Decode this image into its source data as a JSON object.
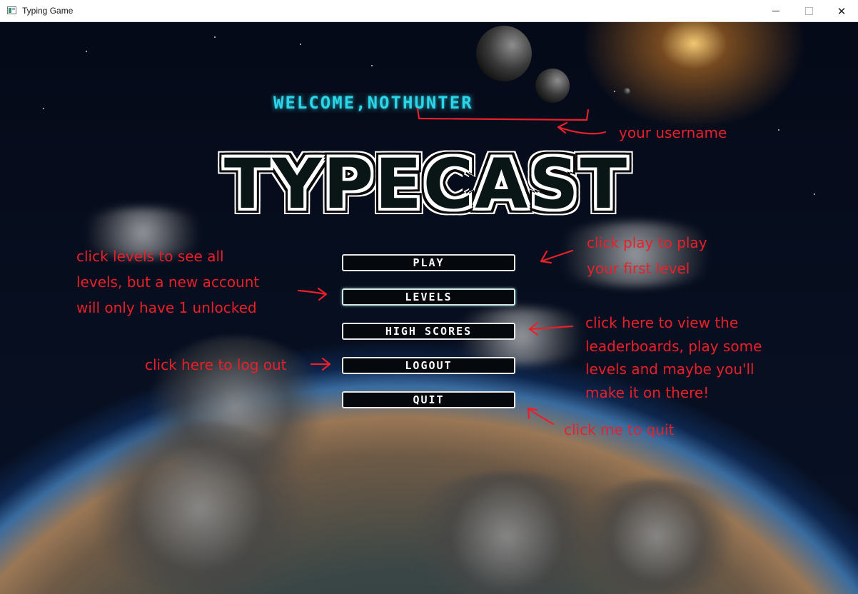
{
  "window": {
    "title": "Typing Game",
    "controls": [
      "minimize",
      "maximize",
      "close"
    ],
    "close_glyph": "✕"
  },
  "game": {
    "welcome_prefix": "WELCOME, ",
    "username": "NOTHUNTER",
    "logo": "TYPECAST",
    "accent_color": "#2ad6e8"
  },
  "menu": {
    "play": "PLAY",
    "levels": "LEVELS",
    "high_scores": "HIGH SCORES",
    "logout": "LOGOUT",
    "quit": "QUIT"
  },
  "annotations": {
    "color": "#e8202a",
    "username_note": "your username",
    "play_note": [
      "click play to play",
      "your first level"
    ],
    "levels_note": [
      "click levels to see all",
      "levels, but a new account",
      "will only have 1 unlocked"
    ],
    "high_scores_note": [
      "click here to view the",
      "leaderboards, play some",
      "levels and maybe you'll",
      "make it on there!"
    ],
    "logout_note": "click here to log out",
    "quit_note": "click me to quit"
  }
}
